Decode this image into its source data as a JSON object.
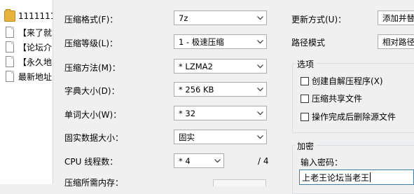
{
  "file_list": {
    "items": [
      {
        "type": "folder",
        "icon": "folder-icon",
        "name": "11111111"
      },
      {
        "type": "file",
        "icon": "document-icon",
        "name": "【来了就"
      },
      {
        "type": "file",
        "icon": "document-icon",
        "name": "【论坛介"
      },
      {
        "type": "file",
        "icon": "document-icon",
        "name": "【永久地"
      },
      {
        "type": "file",
        "icon": "document-icon",
        "name": "最新地址"
      }
    ]
  },
  "compression": {
    "format_label": "压缩格式(F)：",
    "format_value": "7z",
    "level_label": "压缩等级(L)：",
    "level_value": "1 - 极速压缩",
    "method_label": "压缩方法(M)：",
    "method_value": "* LZMA2",
    "dict_label": "字典大小(D)：",
    "dict_value": "* 256 KB",
    "word_label": "单词大小(W)：",
    "word_value": "* 32",
    "solid_label": "固实数据大小：",
    "solid_value": "固实",
    "cpu_label": "CPU 线程数：",
    "cpu_value": "* 4",
    "cpu_total": "/ 4",
    "memory_label": "压缩所需内存："
  },
  "update": {
    "mode_label": "更新方式(U)：",
    "mode_value": "添加并替",
    "path_label": "路径模式",
    "path_value": "相对路径"
  },
  "options": {
    "title": "选项",
    "sfx": "创建自解压程序(X)",
    "shared": "压缩共享文件",
    "delete_after": "操作完成后删除源文件"
  },
  "encryption": {
    "title": "加密",
    "password_label": "输入密码：",
    "password_value": "上老王论坛当老王"
  }
}
